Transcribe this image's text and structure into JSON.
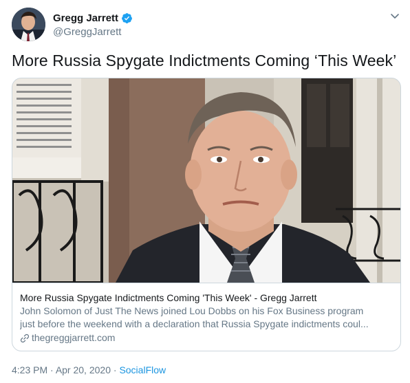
{
  "author": {
    "name": "Gregg Jarrett",
    "handle": "@GreggJarrett",
    "verified": true
  },
  "icons": {
    "avatar": "profile-photo",
    "verified": "verified-badge-icon",
    "menu": "chevron-down-icon",
    "link": "link-icon"
  },
  "tweet": {
    "text": "More Russia Spygate Indictments Coming ‘This Week’"
  },
  "card": {
    "image": "photo of man in suit and tie outside a building",
    "title": "More Russia Spygate Indictments Coming 'This Week' - Gregg Jarrett",
    "description_line1": "John Solomon of Just The News joined Lou Dobbs on his Fox Business program",
    "description_line2": "just before the weekend with a declaration that Russia Spygate indictments coul...",
    "domain": "thegreggjarrett.com"
  },
  "meta": {
    "time": "4:23 PM",
    "separator1": " · ",
    "date": "Apr 20, 2020",
    "separator2": " · ",
    "source": "SocialFlow"
  },
  "colors": {
    "accent": "#1b95e0",
    "text": "#14171a",
    "secondary": "#657786",
    "border": "#ccd6dd"
  }
}
